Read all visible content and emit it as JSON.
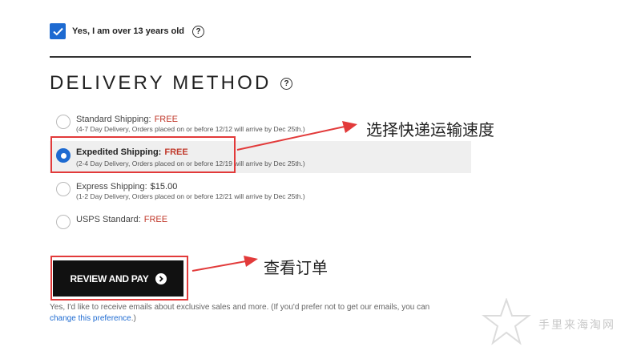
{
  "age_check": {
    "label": "Yes, I am over 13 years old",
    "checked": true,
    "help": "?"
  },
  "delivery": {
    "title": "DELIVERY METHOD",
    "help": "?",
    "options": [
      {
        "name": "Standard Shipping:",
        "price": "FREE",
        "note": "(4-7 Day Delivery, Orders placed on or before 12/12 will arrive by Dec 25th.)",
        "selected": false
      },
      {
        "name": "Expedited Shipping:",
        "price": "FREE",
        "note": "(2-4 Day Delivery, Orders placed on or before 12/19 will arrive by Dec 25th.)",
        "selected": true
      },
      {
        "name": "Express Shipping:",
        "price": "$15.00",
        "note": "(1-2 Day Delivery, Orders placed on or before 12/21 will arrive by Dec 25th.)",
        "selected": false
      },
      {
        "name": "USPS Standard:",
        "price": "FREE",
        "note": "",
        "selected": false
      }
    ]
  },
  "review_button": {
    "label": "REVIEW AND PAY"
  },
  "email_note": {
    "text": "Yes, I'd like to receive emails about exclusive sales and more. (If you'd prefer not to get our emails, you can ",
    "link": "change this preference",
    "end": ".)"
  },
  "annotations": {
    "shipping": "选择快递运输速度",
    "review": "查看订单",
    "arrow_color": "#e23a3a"
  },
  "watermark": "手里来海淘网",
  "colors": {
    "accent": "#1d6ad1",
    "price_red": "#c0392b",
    "annotation_red": "#e23a3a"
  }
}
